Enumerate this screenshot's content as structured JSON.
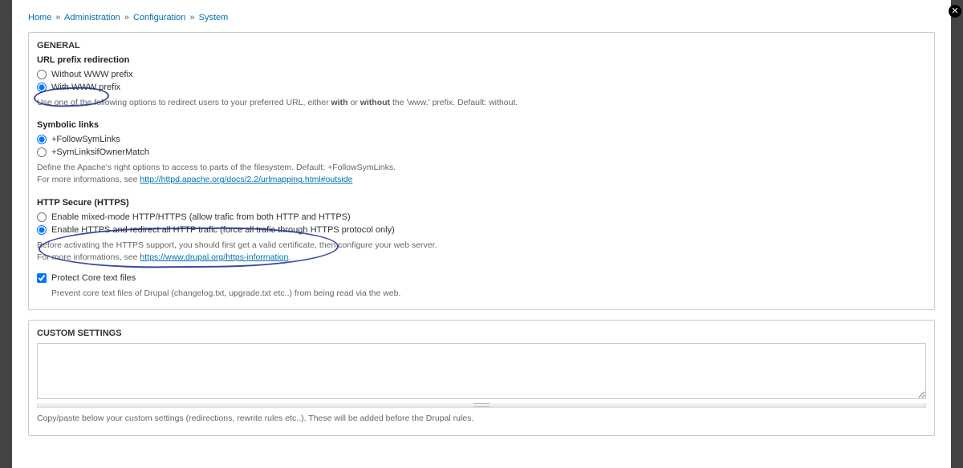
{
  "breadcrumb": {
    "items": [
      "Home",
      "Administration",
      "Configuration",
      "System"
    ],
    "sep": "»"
  },
  "general": {
    "title": "GENERAL",
    "url_prefix": {
      "header": "URL prefix redirection",
      "opt_without": "Without WWW prefix",
      "opt_with": "With WWW prefix",
      "help_pre": "Use one of the following options to redirect users to your preferred URL, either ",
      "help_with": "with",
      "help_or": " or ",
      "help_without_b": "without",
      "help_post": " the 'www.' prefix. Default: without."
    },
    "symlinks": {
      "header": "Symbolic links",
      "opt_follow": "+FollowSymLinks",
      "opt_owner": "+SymLinksifOwnerMatch",
      "help_line1": "Define the Apache's right options to access to parts of the filesystem. Default: +FollowSymLinks.",
      "help_line2_pre": "For more informations, see ",
      "help_link1": "http://httpd.apache.org/docs/2.2/urlmapping.html#outside"
    },
    "https": {
      "header": "HTTP Secure (HTTPS)",
      "opt_mixed": "Enable mixed-mode HTTP/HTTPS (allow trafic from both HTTP and HTTPS)",
      "opt_force": "Enable HTTPS and redirect all HTTP trafic (force all trafic through HTTPS protocol only)",
      "help_line1": "Before activating the HTTPS support, you should first get a valid certificate, then configure your web server.",
      "help_line2_pre": "For more informations, see ",
      "help_link2": "https://www.drupal.org/https-information",
      "help_link2_trail": ".",
      "protect_label": "Protect Core text files",
      "protect_help": "Prevent core text files of Drupal (changelog.txt, upgrade.txt etc..) from being read via the web."
    }
  },
  "custom": {
    "title": "CUSTOM SETTINGS",
    "help": "Copy/paste below your custom settings (redirections, rewrite rules etc..). These will be added before the Drupal rules.",
    "value": ""
  },
  "close_label": "✕"
}
